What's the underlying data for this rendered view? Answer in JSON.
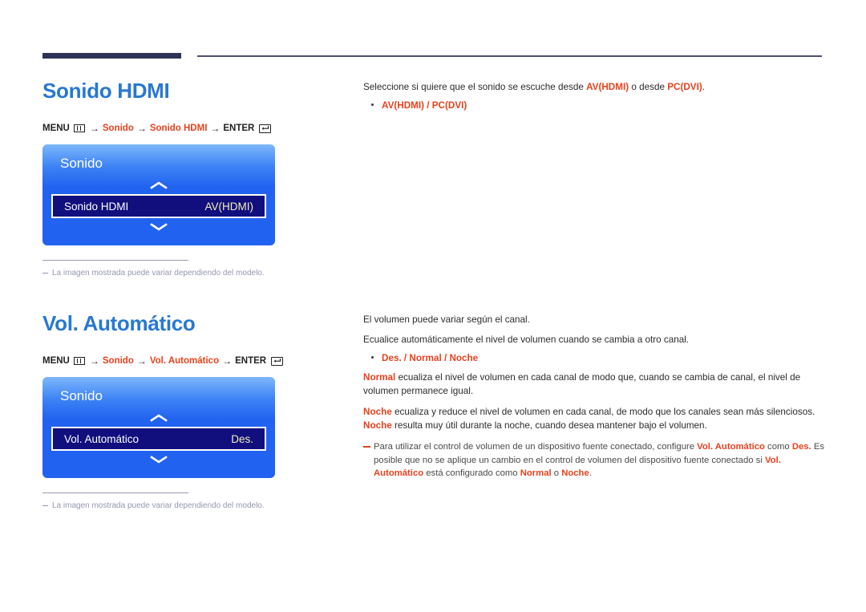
{
  "rules": {
    "thick_color": "#2e3356",
    "thin_color": "#4b4f6b"
  },
  "sections": [
    {
      "title": "Sonido HDMI",
      "menu_path": {
        "menu_label": "MENU",
        "menu_icon": "menu-grid-icon",
        "step1": "Sonido",
        "step2": "Sonido HDMI",
        "enter_label": "ENTER",
        "enter_icon": "enter-return-icon",
        "arrow": "→"
      },
      "tv_box": {
        "title": "Sonido",
        "up_icon": "chevron-up-icon",
        "down_icon": "chevron-down-icon",
        "row_label": "Sonido HDMI",
        "row_value": "AV(HDMI)"
      },
      "footnote": "La imagen mostrada puede variar dependiendo del modelo.",
      "right": {
        "intro_pre": "Seleccione si quiere que el sonido se escuche desde ",
        "intro_hl1": "AV(HDMI)",
        "intro_mid": " o desde ",
        "intro_hl2": "PC(DVI)",
        "intro_post": ".",
        "bullet": "AV(HDMI) / PC(DVI)"
      }
    },
    {
      "title": "Vol. Automático",
      "menu_path": {
        "menu_label": "MENU",
        "menu_icon": "menu-grid-icon",
        "step1": "Sonido",
        "step2": "Vol. Automático",
        "enter_label": "ENTER",
        "enter_icon": "enter-return-icon",
        "arrow": "→"
      },
      "tv_box": {
        "title": "Sonido",
        "up_icon": "chevron-up-icon",
        "down_icon": "chevron-down-icon",
        "row_label": "Vol. Automático",
        "row_value": "Des."
      },
      "footnote": "La imagen mostrada puede variar dependiendo del modelo.",
      "right": {
        "line1": "El volumen puede variar según el canal.",
        "line2": "Ecualice automáticamente el nivel de volumen cuando se cambia a otro canal.",
        "bullet": "Des. / Normal / Noche",
        "para_normal_hl": "Normal",
        "para_normal_rest": " ecualiza el nivel de volumen en cada canal de modo que, cuando se cambia de canal, el nivel de volumen permanece igual.",
        "para_noche_hl1": "Noche",
        "para_noche_mid": " ecualiza y reduce el nivel de volumen en cada canal, de modo que los canales sean más silenciosos. ",
        "para_noche_hl2": "Noche",
        "para_noche_rest": " resulta muy útil durante la noche, cuando desea mantener bajo el volumen.",
        "note_a": "Para utilizar el control de volumen de un dispositivo fuente conectado, configure ",
        "note_hl1": "Vol. Automático",
        "note_b": " como ",
        "note_hl2": "Des.",
        "note_c": " Es posible que no se aplique un cambio en el control de volumen del dispositivo fuente conectado si ",
        "note_hl3": "Vol. Automático",
        "note_d": " está configurado como ",
        "note_hl4": "Normal",
        "note_e": " o ",
        "note_hl5": "Noche",
        "note_f": "."
      }
    }
  ]
}
